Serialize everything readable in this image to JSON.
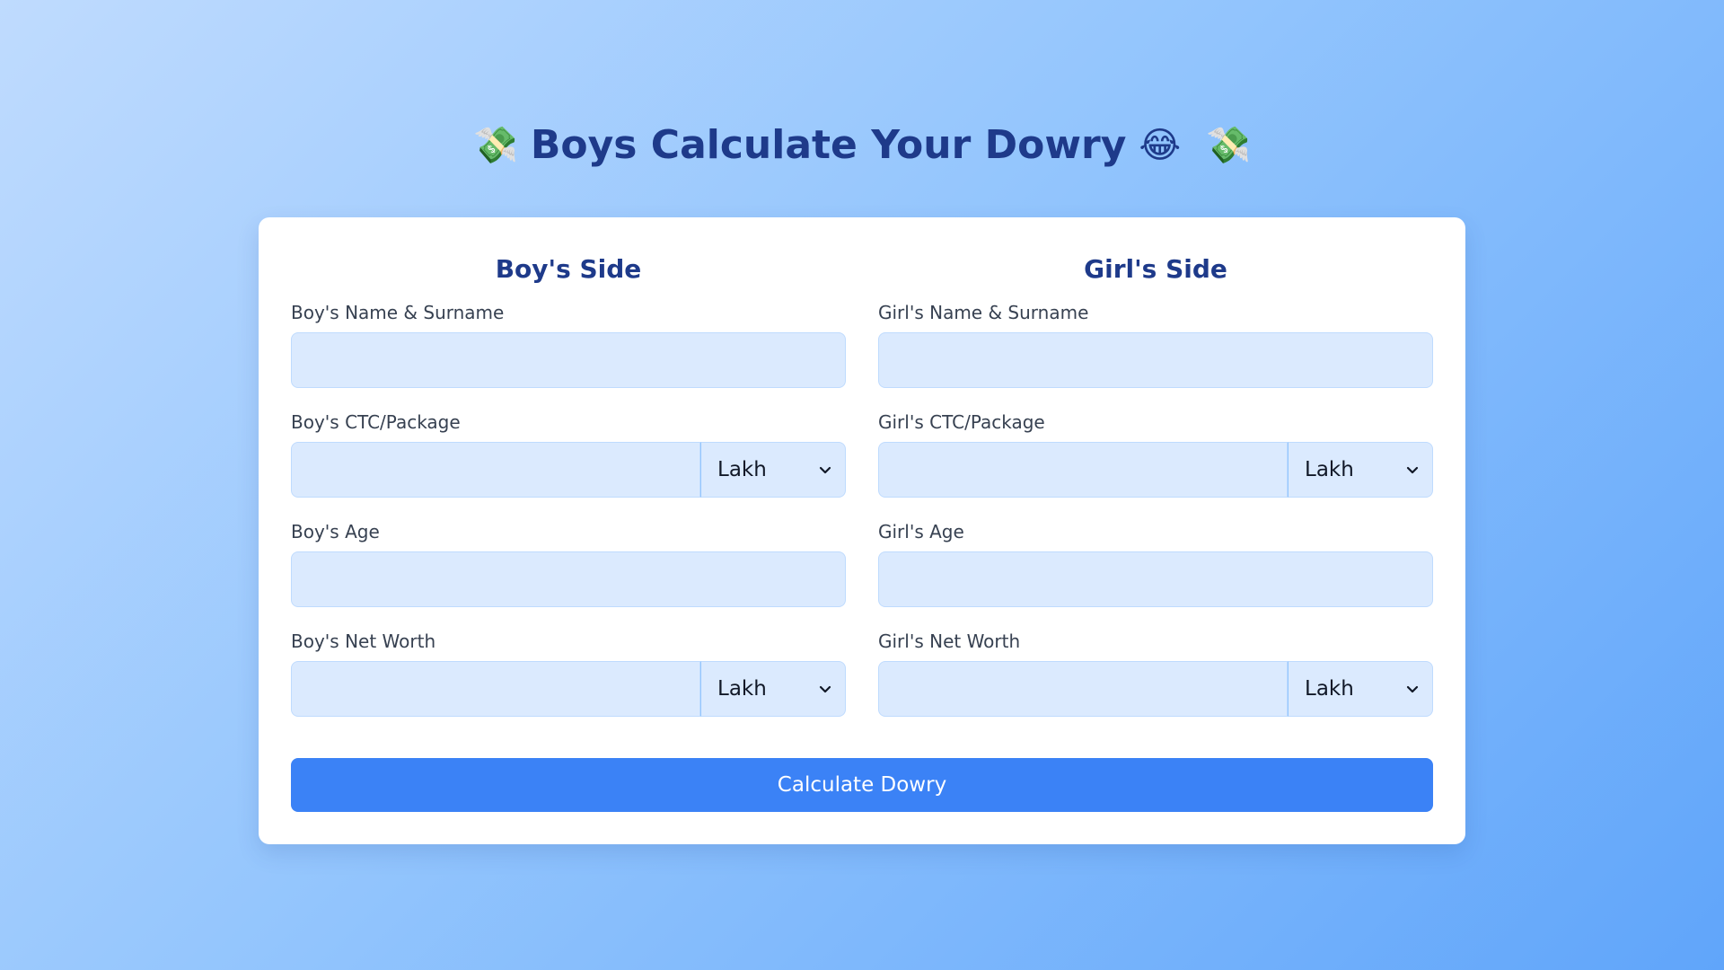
{
  "header": {
    "emoji_left": "💸",
    "title": "Boys Calculate Your Dowry",
    "emoji_laugh": "😂",
    "emoji_right": "💸"
  },
  "boy": {
    "heading": "Boy's Side",
    "name_label": "Boy's Name & Surname",
    "name_value": "",
    "ctc_label": "Boy's CTC/Package",
    "ctc_value": "",
    "ctc_unit": "Lakh",
    "age_label": "Boy's Age",
    "age_value": "",
    "networth_label": "Boy's Net Worth",
    "networth_value": "",
    "networth_unit": "Lakh"
  },
  "girl": {
    "heading": "Girl's Side",
    "name_label": "Girl's Name & Surname",
    "name_value": "",
    "ctc_label": "Girl's CTC/Package",
    "ctc_value": "",
    "ctc_unit": "Lakh",
    "age_label": "Girl's Age",
    "age_value": "",
    "networth_label": "Girl's Net Worth",
    "networth_value": "",
    "networth_unit": "Lakh"
  },
  "actions": {
    "calculate_label": "Calculate Dowry"
  },
  "colors": {
    "accent": "#3b82f6",
    "heading": "#1e3a8a",
    "input_bg": "#dbeafe"
  }
}
